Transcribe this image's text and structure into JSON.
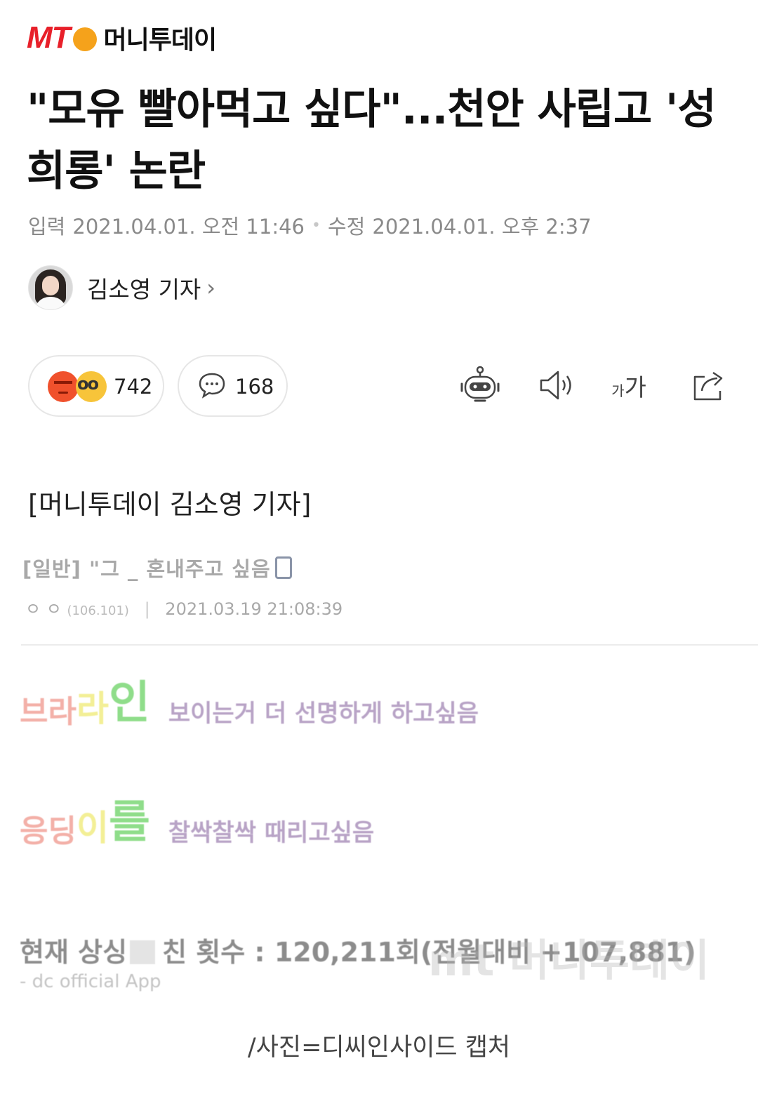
{
  "brand": {
    "logo_text": "MT",
    "name": "머니투데이",
    "logo_color": "#e8202a",
    "logo_accent": "#f5a21b"
  },
  "headline": "\"모유 빨아먹고 싶다\"...천안 사립고 '성희롱' 논란",
  "meta": {
    "published_label": "입력",
    "published": "2021.04.01. 오전 11:46",
    "modified_label": "수정",
    "modified": "2021.04.01. 오후 2:37"
  },
  "reporter": {
    "name": "김소영 기자",
    "chevron": "›"
  },
  "actions": {
    "reactions_count": "742",
    "comments_count": "168",
    "tools": [
      "robot-icon",
      "speaker-icon",
      "font-size-icon",
      "share-icon"
    ],
    "font_small": "가",
    "font_big": "가"
  },
  "byline": "[머니투데이 김소영 기자]",
  "capture": {
    "post_title": "[일반] \"그 _ 혼내주고 싶음",
    "post_author": "ㅇ ㅇ",
    "post_ip": "(106.101)",
    "post_time": "2021.03.19 21:08:39",
    "line1_colored": [
      "브",
      "라",
      "라",
      "인"
    ],
    "line1_text": "보이는거 더 선명하게 하고싶음",
    "line2_colored": [
      "응",
      "딩",
      "이",
      "를"
    ],
    "line2_text": "찰싹찰싹 때리고싶음",
    "stat_prefix": "현재 상싱",
    "stat_suffix": "친 횟수 : 120,211회(전월대비 +107,881)",
    "dc_app": "- dc official App",
    "watermark": "mt 머니투데이"
  },
  "caption": "/사진=디씨인사이드 캡처"
}
